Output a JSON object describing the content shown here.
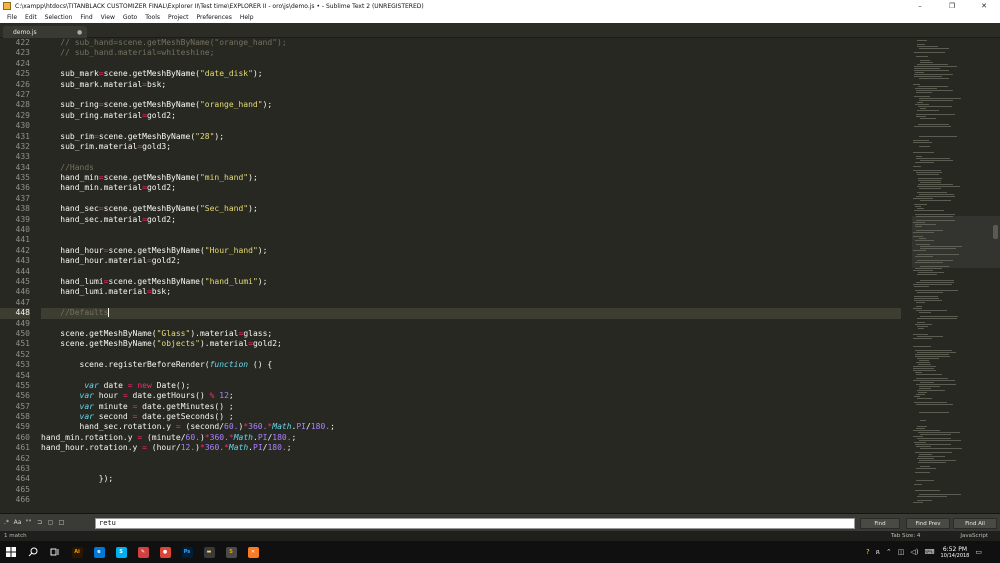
{
  "window": {
    "title": "C:\\xampp\\htdocs\\TITANBLACK CUSTOMIZER FINAL\\Explorer II\\Test time\\EXPLORER II - oro\\js\\demo.js • - Sublime Text 2 (UNREGISTERED)",
    "minimize_glyph": "–",
    "maximize_glyph": "❐",
    "close_glyph": "✕"
  },
  "menu": [
    "File",
    "Edit",
    "Selection",
    "Find",
    "View",
    "Goto",
    "Tools",
    "Project",
    "Preferences",
    "Help"
  ],
  "tab": {
    "label": "demo.js",
    "close_glyph": "●"
  },
  "editor": {
    "current_line": "448",
    "lines": [
      {
        "n": "422",
        "tokens": [
          [
            "c",
            "    // sub_hand=scene.getMeshByName(\"orange_hand\");"
          ]
        ]
      },
      {
        "n": "423",
        "tokens": [
          [
            "c",
            "    // sub_hand.material=whiteshine;"
          ]
        ]
      },
      {
        "n": "424",
        "tokens": []
      },
      {
        "n": "425",
        "tokens": [
          [
            "p",
            "    sub_mark"
          ],
          [
            "o",
            "="
          ],
          [
            "p",
            "scene.getMeshByName("
          ],
          [
            "s",
            "\"date_disk\""
          ],
          [
            "p",
            ");"
          ]
        ]
      },
      {
        "n": "426",
        "tokens": [
          [
            "p",
            "    sub_mark.material"
          ],
          [
            "o",
            "="
          ],
          [
            "p",
            "bsk;"
          ]
        ]
      },
      {
        "n": "427",
        "tokens": []
      },
      {
        "n": "428",
        "tokens": [
          [
            "p",
            "    sub_ring"
          ],
          [
            "o",
            "="
          ],
          [
            "p",
            "scene.getMeshByName("
          ],
          [
            "s",
            "\"orange_hand\""
          ],
          [
            "p",
            ");"
          ]
        ]
      },
      {
        "n": "429",
        "tokens": [
          [
            "p",
            "    sub_ring.material"
          ],
          [
            "o",
            "="
          ],
          [
            "p",
            "gold2;"
          ]
        ]
      },
      {
        "n": "430",
        "tokens": []
      },
      {
        "n": "431",
        "tokens": [
          [
            "p",
            "    sub_rim"
          ],
          [
            "o",
            "="
          ],
          [
            "p",
            "scene.getMeshByName("
          ],
          [
            "s",
            "\"28\""
          ],
          [
            "p",
            ");"
          ]
        ]
      },
      {
        "n": "432",
        "tokens": [
          [
            "p",
            "    sub_rim.material"
          ],
          [
            "o",
            "="
          ],
          [
            "p",
            "gold3;"
          ]
        ]
      },
      {
        "n": "433",
        "tokens": []
      },
      {
        "n": "434",
        "tokens": [
          [
            "c",
            "    //Hands"
          ]
        ]
      },
      {
        "n": "435",
        "tokens": [
          [
            "p",
            "    hand_min"
          ],
          [
            "o",
            "="
          ],
          [
            "p",
            "scene.getMeshByName("
          ],
          [
            "s",
            "\"min_hand\""
          ],
          [
            "p",
            ");"
          ]
        ]
      },
      {
        "n": "436",
        "tokens": [
          [
            "p",
            "    hand_min.material"
          ],
          [
            "o",
            "="
          ],
          [
            "p",
            "gold2;"
          ]
        ]
      },
      {
        "n": "437",
        "tokens": []
      },
      {
        "n": "438",
        "tokens": [
          [
            "p",
            "    hand_sec"
          ],
          [
            "o",
            "="
          ],
          [
            "p",
            "scene.getMeshByName("
          ],
          [
            "s",
            "\"Sec_hand\""
          ],
          [
            "p",
            ");"
          ]
        ]
      },
      {
        "n": "439",
        "tokens": [
          [
            "p",
            "    hand_sec.material"
          ],
          [
            "o",
            "="
          ],
          [
            "p",
            "gold2;"
          ]
        ]
      },
      {
        "n": "440",
        "tokens": []
      },
      {
        "n": "441",
        "tokens": []
      },
      {
        "n": "442",
        "tokens": [
          [
            "p",
            "    hand_hour"
          ],
          [
            "o",
            "="
          ],
          [
            "p",
            "scene.getMeshByName("
          ],
          [
            "s",
            "\"Hour_hand\""
          ],
          [
            "p",
            ");"
          ]
        ]
      },
      {
        "n": "443",
        "tokens": [
          [
            "p",
            "    hand_hour.material"
          ],
          [
            "o",
            "="
          ],
          [
            "p",
            "gold2;"
          ]
        ]
      },
      {
        "n": "444",
        "tokens": []
      },
      {
        "n": "445",
        "tokens": [
          [
            "p",
            "    hand_lumi"
          ],
          [
            "o",
            "="
          ],
          [
            "p",
            "scene.getMeshByName("
          ],
          [
            "s",
            "\"hand_lumi\""
          ],
          [
            "p",
            ");"
          ]
        ]
      },
      {
        "n": "446",
        "tokens": [
          [
            "p",
            "    hand_lumi.material"
          ],
          [
            "o",
            "="
          ],
          [
            "p",
            "bsk;"
          ]
        ]
      },
      {
        "n": "447",
        "tokens": []
      },
      {
        "n": "448",
        "tokens": [
          [
            "c",
            "    //Defaults"
          ]
        ]
      },
      {
        "n": "449",
        "tokens": []
      },
      {
        "n": "450",
        "tokens": [
          [
            "p",
            "    scene.getMeshByName("
          ],
          [
            "s",
            "\"Glass\""
          ],
          [
            "p",
            ").material"
          ],
          [
            "o",
            "="
          ],
          [
            "p",
            "glass;"
          ]
        ]
      },
      {
        "n": "451",
        "tokens": [
          [
            "p",
            "    scene.getMeshByName("
          ],
          [
            "s",
            "\"objects\""
          ],
          [
            "p",
            ").material"
          ],
          [
            "o",
            "="
          ],
          [
            "p",
            "gold2;"
          ]
        ]
      },
      {
        "n": "452",
        "tokens": []
      },
      {
        "n": "453",
        "tokens": [
          [
            "p",
            "        scene.registerBeforeRender("
          ],
          [
            "k",
            "function"
          ],
          [
            "p",
            " () {"
          ]
        ]
      },
      {
        "n": "454",
        "tokens": []
      },
      {
        "n": "455",
        "tokens": [
          [
            "k",
            "         var"
          ],
          [
            "p",
            " date "
          ],
          [
            "o",
            "="
          ],
          [
            "p",
            " "
          ],
          [
            "o",
            "new"
          ],
          [
            "p",
            " Date();"
          ]
        ]
      },
      {
        "n": "456",
        "tokens": [
          [
            "k",
            "        var"
          ],
          [
            "p",
            " hour "
          ],
          [
            "o",
            "="
          ],
          [
            "p",
            " date.getHours() "
          ],
          [
            "o",
            "%"
          ],
          [
            "p",
            " "
          ],
          [
            "n",
            "12"
          ],
          [
            "p",
            ";"
          ]
        ]
      },
      {
        "n": "457",
        "tokens": [
          [
            "k",
            "        var"
          ],
          [
            "p",
            " minute "
          ],
          [
            "o",
            "="
          ],
          [
            "p",
            " date.getMinutes() ;"
          ]
        ]
      },
      {
        "n": "458",
        "tokens": [
          [
            "k",
            "        var"
          ],
          [
            "p",
            " second "
          ],
          [
            "o",
            "="
          ],
          [
            "p",
            " date.getSeconds() ;"
          ]
        ]
      },
      {
        "n": "459",
        "tokens": [
          [
            "p",
            "        hand_sec.rotation.y "
          ],
          [
            "o",
            "="
          ],
          [
            "p",
            " (second/"
          ],
          [
            "n",
            "60."
          ],
          [
            "p",
            ")"
          ],
          [
            "o",
            "*"
          ],
          [
            "n",
            "360."
          ],
          [
            "o",
            "*"
          ],
          [
            "k",
            "Math"
          ],
          [
            "p",
            "."
          ],
          [
            "n",
            "PI"
          ],
          [
            "p",
            "/"
          ],
          [
            "n",
            "180."
          ],
          [
            "p",
            ";"
          ]
        ]
      },
      {
        "n": "460",
        "tokens": [
          [
            "p",
            "hand_min.rotation.y "
          ],
          [
            "o",
            "="
          ],
          [
            "p",
            " (minute/"
          ],
          [
            "n",
            "60."
          ],
          [
            "p",
            ")"
          ],
          [
            "o",
            "*"
          ],
          [
            "n",
            "360."
          ],
          [
            "o",
            "*"
          ],
          [
            "k",
            "Math"
          ],
          [
            "p",
            "."
          ],
          [
            "n",
            "PI"
          ],
          [
            "p",
            "/"
          ],
          [
            "n",
            "180."
          ],
          [
            "p",
            ";"
          ]
        ]
      },
      {
        "n": "461",
        "tokens": [
          [
            "p",
            "hand_hour.rotation.y "
          ],
          [
            "o",
            "="
          ],
          [
            "p",
            " (hour/"
          ],
          [
            "n",
            "12."
          ],
          [
            "p",
            ")"
          ],
          [
            "o",
            "*"
          ],
          [
            "n",
            "360."
          ],
          [
            "o",
            "*"
          ],
          [
            "k",
            "Math"
          ],
          [
            "p",
            "."
          ],
          [
            "n",
            "PI"
          ],
          [
            "p",
            "/"
          ],
          [
            "n",
            "180."
          ],
          [
            "p",
            ";"
          ]
        ]
      },
      {
        "n": "462",
        "tokens": []
      },
      {
        "n": "463",
        "tokens": []
      },
      {
        "n": "464",
        "tokens": [
          [
            "p",
            "            });"
          ]
        ]
      },
      {
        "n": "465",
        "tokens": []
      },
      {
        "n": "466",
        "tokens": []
      }
    ]
  },
  "find_panel": {
    "options": [
      ".*",
      "Aa",
      "\"\"",
      "⊐",
      "▢",
      "□"
    ],
    "query": "retu",
    "find_label": "Find",
    "find_prev_label": "Find Prev",
    "find_all_label": "Find All"
  },
  "status": {
    "left": "1 match",
    "tab_size": "Tab Size: 4",
    "syntax": "JavaScript"
  },
  "taskbar": {
    "time": "6:52 PM",
    "date": "10/14/2018",
    "apps": [
      {
        "name": "illustrator-icon",
        "label": "Ai",
        "color": "#ff9a00",
        "bg": "#2b1700"
      },
      {
        "name": "edge-icon",
        "label": "e",
        "color": "#ffffff",
        "bg": "#0078d7"
      },
      {
        "name": "skype-icon",
        "label": "S",
        "color": "#ffffff",
        "bg": "#00aff0"
      },
      {
        "name": "paint-icon",
        "label": "✎",
        "color": "#ffffff",
        "bg": "#d04040"
      },
      {
        "name": "chrome-icon",
        "label": "●",
        "color": "#ffffff",
        "bg": "#db4437"
      },
      {
        "name": "photoshop-icon",
        "label": "Ps",
        "color": "#31a8ff",
        "bg": "#001e36"
      },
      {
        "name": "file-explorer-icon",
        "label": "▬",
        "color": "#ffd15c",
        "bg": "#3a3a3a"
      },
      {
        "name": "sublime-icon",
        "label": "S",
        "color": "#ff9800",
        "bg": "#4a4a4a"
      },
      {
        "name": "xampp-icon",
        "label": "✕",
        "color": "#ffffff",
        "bg": "#fb7a24"
      }
    ]
  }
}
